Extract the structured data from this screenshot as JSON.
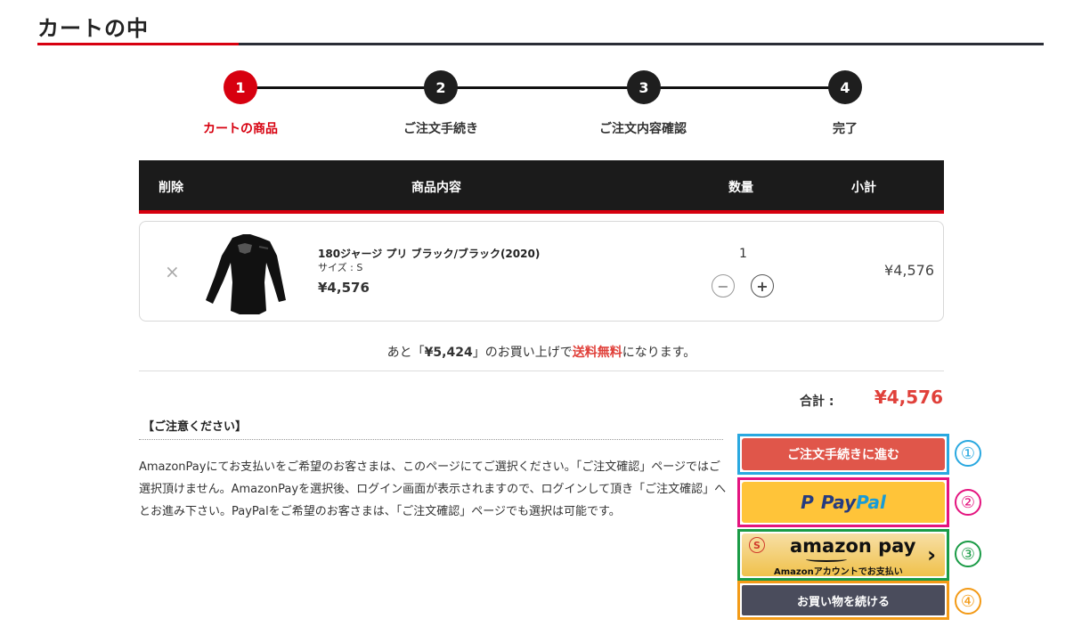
{
  "page": {
    "title": "カートの中"
  },
  "steps": [
    {
      "num": "1",
      "label": "カートの商品"
    },
    {
      "num": "2",
      "label": "ご注文手続き"
    },
    {
      "num": "3",
      "label": "ご注文内容確認"
    },
    {
      "num": "4",
      "label": "完了"
    }
  ],
  "table": {
    "headers": {
      "delete": "削除",
      "content": "商品内容",
      "qty": "数量",
      "subtotal": "小計"
    }
  },
  "item": {
    "remove": "×",
    "name": "180ジャージ プリ ブラック/ブラック(2020)",
    "size": "サイズ : S",
    "price": "¥4,576",
    "quantity": "1",
    "minus": "−",
    "plus": "+",
    "subtotal": "¥4,576"
  },
  "shipping_msg": {
    "prefix": "あと「",
    "amount": "¥5,424",
    "middle": "」のお買い上げで",
    "highlight": "送料無料",
    "suffix": "になります。"
  },
  "total": {
    "label": "合計 :",
    "value": "¥4,576"
  },
  "notice": {
    "title": "【ご注意ください】",
    "body": "AmazonPayにてお支払いをご希望のお客さまは、このページにてご選択ください。「ご注文確認」ページではご選択頂けません。AmazonPayを選択後、ログイン画面が表示されますので、ログインして頂き「ご注文確認」へとお進み下さい。PayPalをご希望のお客さまは、「ご注文確認」ページでも選択は可能です。"
  },
  "actions": {
    "checkout": "ご注文手続きに進む",
    "paypal_p": "P",
    "paypal_pay": "Pay",
    "paypal_pal": "Pal",
    "amazon_logo": "amazon pay",
    "amazon_sub": "Amazonアカウントでお支払い",
    "amazon_badge": "S",
    "amazon_chevron": "›",
    "continue": "お買い物を続ける"
  },
  "annotations": [
    "①",
    "②",
    "③",
    "④"
  ],
  "colors": {
    "accent_red": "#d7000f",
    "price_red": "#e0403a",
    "anno_blue": "#29a8e0",
    "anno_magenta": "#e4147f",
    "anno_green": "#1a9b46",
    "anno_orange": "#f39a16"
  }
}
